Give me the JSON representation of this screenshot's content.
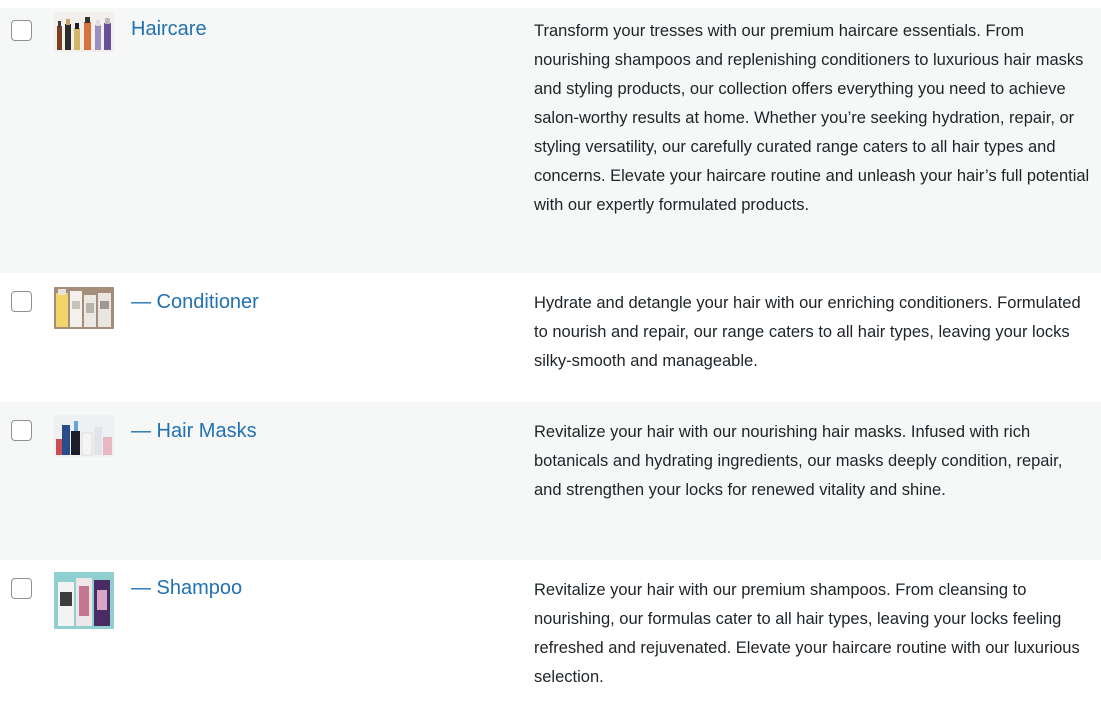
{
  "categories": [
    {
      "name": "Haircare",
      "thumbnail_icon": "haircare-products-thumbnail",
      "description": "Transform your tresses with our premium haircare essentials. From nourishing shampoos and replenishing conditioners to luxurious hair masks and styling products, our collection offers everything you need to achieve salon-worthy results at home. Whether you’re seeking hydration, repair, or styling versatility, our carefully curated range caters to all hair types and concerns. Elevate your haircare routine and unleash your hair’s full potential with our expertly formulated products."
    },
    {
      "name": "— Conditioner",
      "thumbnail_icon": "conditioner-products-thumbnail",
      "description": "Hydrate and detangle your hair with our enriching conditioners. Formulated to nourish and repair, our range caters to all hair types, leaving your locks silky-smooth and manageable."
    },
    {
      "name": "— Hair Masks",
      "thumbnail_icon": "hair-masks-products-thumbnail",
      "description": "Revitalize your hair with our nourishing hair masks. Infused with rich botanicals and hydrating ingredients, our masks deeply condition, repair, and strengthen your locks for renewed vitality and shine."
    },
    {
      "name": "— Shampoo",
      "thumbnail_icon": "shampoo-products-thumbnail",
      "description": "Revitalize your hair with our premium shampoos. From cleansing to nourishing, our formulas cater to all hair types, leaving your locks feeling refreshed and rejuvenated. Elevate your haircare routine with our luxurious selection."
    }
  ],
  "colors": {
    "link": "#2271b1",
    "text": "#1d2327",
    "row_alt": "#f6f7f7",
    "checkbox_border": "#8c8f94"
  }
}
